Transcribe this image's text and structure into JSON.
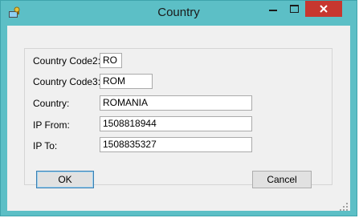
{
  "window": {
    "title": "Country"
  },
  "titlebar": {
    "app_icon": "key-icon",
    "controls": {
      "minimize": "minimize-icon",
      "maximize": "maximize-icon",
      "close": "close-icon"
    }
  },
  "form": {
    "code2": {
      "label": "Country Code2:",
      "value": "RO"
    },
    "code3": {
      "label": "Country Code3:",
      "value": "ROM"
    },
    "country": {
      "label": "Country:",
      "value": "ROMANIA"
    },
    "ip_from": {
      "label": "IP From:",
      "value": "1508818944"
    },
    "ip_to": {
      "label": "IP To:",
      "value": "1508835327"
    }
  },
  "buttons": {
    "ok": "OK",
    "cancel": "Cancel"
  },
  "colors": {
    "frame": "#5cbfc6",
    "close": "#c7372f",
    "client": "#f0f0f0"
  }
}
